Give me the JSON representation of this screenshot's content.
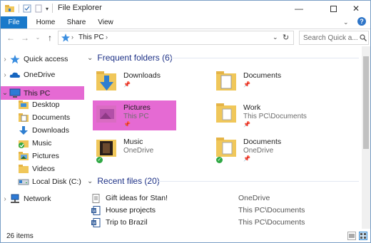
{
  "window": {
    "title": "File Explorer"
  },
  "ribbon": {
    "tabs": [
      "File",
      "Home",
      "Share",
      "View"
    ]
  },
  "address": {
    "path": "This PC",
    "separator": "›",
    "search_placeholder": "Search Quick a..."
  },
  "nav": {
    "items": [
      {
        "label": "Quick access",
        "icon": "star-icon"
      },
      {
        "label": "OneDrive",
        "icon": "cloud-icon"
      },
      {
        "label": "This PC",
        "icon": "computer-icon"
      },
      {
        "label": "Desktop",
        "icon": "folder-icon"
      },
      {
        "label": "Documents",
        "icon": "documents-icon"
      },
      {
        "label": "Downloads",
        "icon": "download-icon"
      },
      {
        "label": "Music",
        "icon": "music-icon"
      },
      {
        "label": "Pictures",
        "icon": "pictures-icon"
      },
      {
        "label": "Videos",
        "icon": "folder-icon"
      },
      {
        "label": "Local Disk (C:)",
        "icon": "disk-icon"
      },
      {
        "label": "Network",
        "icon": "network-icon"
      }
    ]
  },
  "frequent": {
    "header": "Frequent folders (6)",
    "folders": [
      {
        "name": "Downloads",
        "sub": "",
        "pinned": true
      },
      {
        "name": "Documents",
        "sub": "",
        "pinned": true
      },
      {
        "name": "Pictures",
        "sub": "This PC",
        "pinned": true
      },
      {
        "name": "Work",
        "sub": "This PC\\Documents",
        "pinned": true
      },
      {
        "name": "Music",
        "sub": "OneDrive",
        "pinned": false
      },
      {
        "name": "Documents",
        "sub": "OneDrive",
        "pinned": true
      }
    ]
  },
  "recent": {
    "header": "Recent files (20)",
    "files": [
      {
        "name": "Gift ideas for Stan!",
        "location": "OneDrive",
        "icon": "text-file-icon"
      },
      {
        "name": "House projects",
        "location": "This PC\\Documents",
        "icon": "word-doc-icon"
      },
      {
        "name": "Trip to Brazil",
        "location": "This PC\\Documents",
        "icon": "word-doc-icon"
      }
    ]
  },
  "status": {
    "count": "26 items"
  },
  "colors": {
    "highlight": "#e56ad3",
    "accent": "#1979ca",
    "section": "#1e3287"
  }
}
